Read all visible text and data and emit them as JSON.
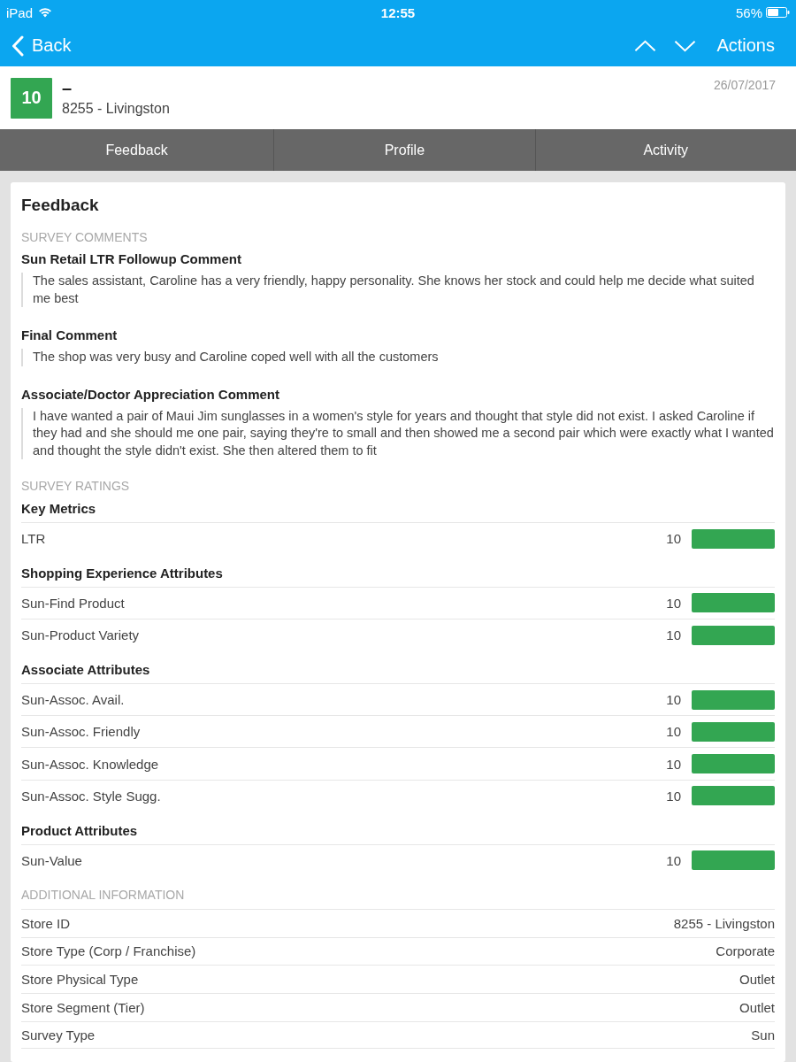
{
  "status_bar": {
    "carrier": "iPad",
    "time": "12:55",
    "battery": "56%"
  },
  "nav_bar": {
    "back": "Back",
    "actions": "Actions"
  },
  "header": {
    "score": "10",
    "title": "–",
    "store": "8255 - Livingston",
    "date": "26/07/2017"
  },
  "tabs": [
    {
      "label": "Feedback"
    },
    {
      "label": "Profile"
    },
    {
      "label": "Activity"
    }
  ],
  "feedback": {
    "title": "Feedback",
    "comments_heading": "SURVEY COMMENTS",
    "comments": [
      {
        "question": "Sun Retail LTR Followup Comment",
        "answer": "The sales assistant, Caroline has a very friendly, happy personality. She knows her stock and could help me decide what suited me best"
      },
      {
        "question": "Final Comment",
        "answer": "The shop was very busy and Caroline coped well with all the customers"
      },
      {
        "question": "Associate/Doctor Appreciation Comment",
        "answer": "I have wanted a pair of Maui Jim sunglasses in a women's style for years and thought that style did not exist. I asked Caroline if they had and she should me one pair, saying they're to small and then showed me a second pair which were exactly what I wanted and thought the style didn't exist. She then altered them to fit"
      }
    ],
    "ratings_heading": "SURVEY RATINGS",
    "rating_groups": [
      {
        "title": "Key Metrics",
        "items": [
          {
            "label": "LTR",
            "score": "10",
            "level": 1
          }
        ]
      },
      {
        "title": "Shopping Experience Attributes",
        "items": [
          {
            "label": "Sun-Find Product",
            "score": "10",
            "level": 1
          },
          {
            "label": "Sun-Product Variety",
            "score": "10",
            "level": 1
          }
        ]
      },
      {
        "title": "Associate Attributes",
        "items": [
          {
            "label": "Sun-Assoc. Avail.",
            "score": "10",
            "level": 1
          },
          {
            "label": "Sun-Assoc. Friendly",
            "score": "10",
            "level": 1
          },
          {
            "label": "Sun-Assoc. Knowledge",
            "score": "10",
            "level": 1
          },
          {
            "label": "Sun-Assoc. Style Sugg.",
            "score": "10",
            "level": 1
          }
        ]
      },
      {
        "title": "Product Attributes",
        "items": [
          {
            "label": "Sun-Value",
            "score": "10",
            "level": 1
          }
        ]
      }
    ],
    "info_heading": "ADDITIONAL INFORMATION",
    "info": [
      {
        "label": "Store ID",
        "value": "8255 - Livingston"
      },
      {
        "label": "Store Type (Corp / Franchise)",
        "value": "Corporate"
      },
      {
        "label": "Store Physical Type",
        "value": "Outlet"
      },
      {
        "label": "Store Segment (Tier)",
        "value": "Outlet"
      },
      {
        "label": "Survey Type",
        "value": "Sun"
      }
    ]
  }
}
